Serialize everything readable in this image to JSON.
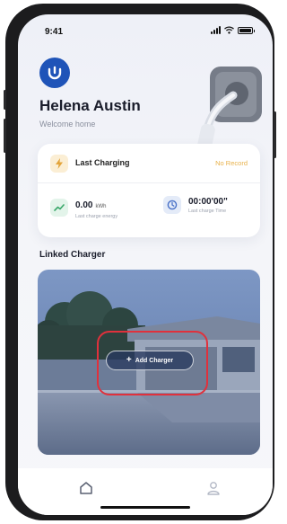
{
  "status_bar": {
    "time": "9:41"
  },
  "header": {
    "user_name": "Helena Austin",
    "welcome": "Welcome home"
  },
  "summary_card": {
    "last_charging_label": "Last Charging",
    "last_charging_status": "No Record",
    "energy": {
      "value": "0.00",
      "unit": "kWh",
      "label": "Last charge energy"
    },
    "duration": {
      "value": "00:00'00\"",
      "label": "Last charge Time"
    }
  },
  "linked_charger": {
    "title": "Linked  Charger",
    "add_button_label": "Add Charger"
  },
  "tabs": [
    {
      "icon": "home-icon"
    },
    {
      "icon": "profile-icon"
    }
  ],
  "colors": {
    "brand_blue": "#1f54b8",
    "highlight_red": "#e0313c",
    "accent_orange": "#e8b14a"
  }
}
